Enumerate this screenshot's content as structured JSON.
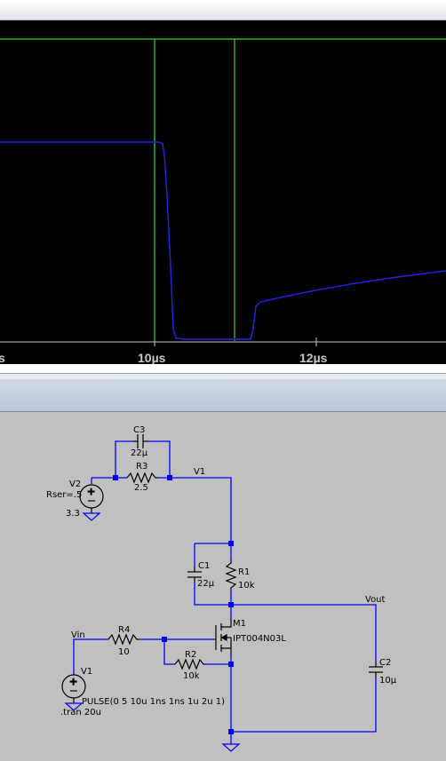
{
  "waveform": {
    "tick_labels": [
      "s",
      "10µs",
      "12µs"
    ],
    "colors": {
      "background": "#000000",
      "trace_input": "#3dd03d",
      "trace_output": "#2323e0",
      "axis_text": "#c8c8c8"
    }
  },
  "schematic": {
    "labels": {
      "C3_name": "C3",
      "C3_value": "22µ",
      "R3_name": "R3",
      "R3_value": "2.5",
      "V2_name": "V2",
      "V2_param": "Rser=.5",
      "V2_value": "3.3",
      "net_v1": "V1",
      "C1_name": "C1",
      "C1_value": "22µ",
      "R1_name": "R1",
      "R1_value": "10k",
      "M1_name": "M1",
      "M1_model": "IPT004N03L",
      "net_vout": "Vout",
      "net_vin": "Vin",
      "R4_name": "R4",
      "R4_value": "10",
      "R2_name": "R2",
      "R2_value": "10k",
      "C2_name": "C2",
      "C2_value": "10µ",
      "V1_name": "V1",
      "V1_source": "PULSE(0 5 10u 1ns 1ns 1u 2u 1)",
      "directive": ".tran 20u"
    },
    "colors": {
      "wire": "#0000ff",
      "background": "#c0c0c0",
      "component": "#000000"
    }
  }
}
